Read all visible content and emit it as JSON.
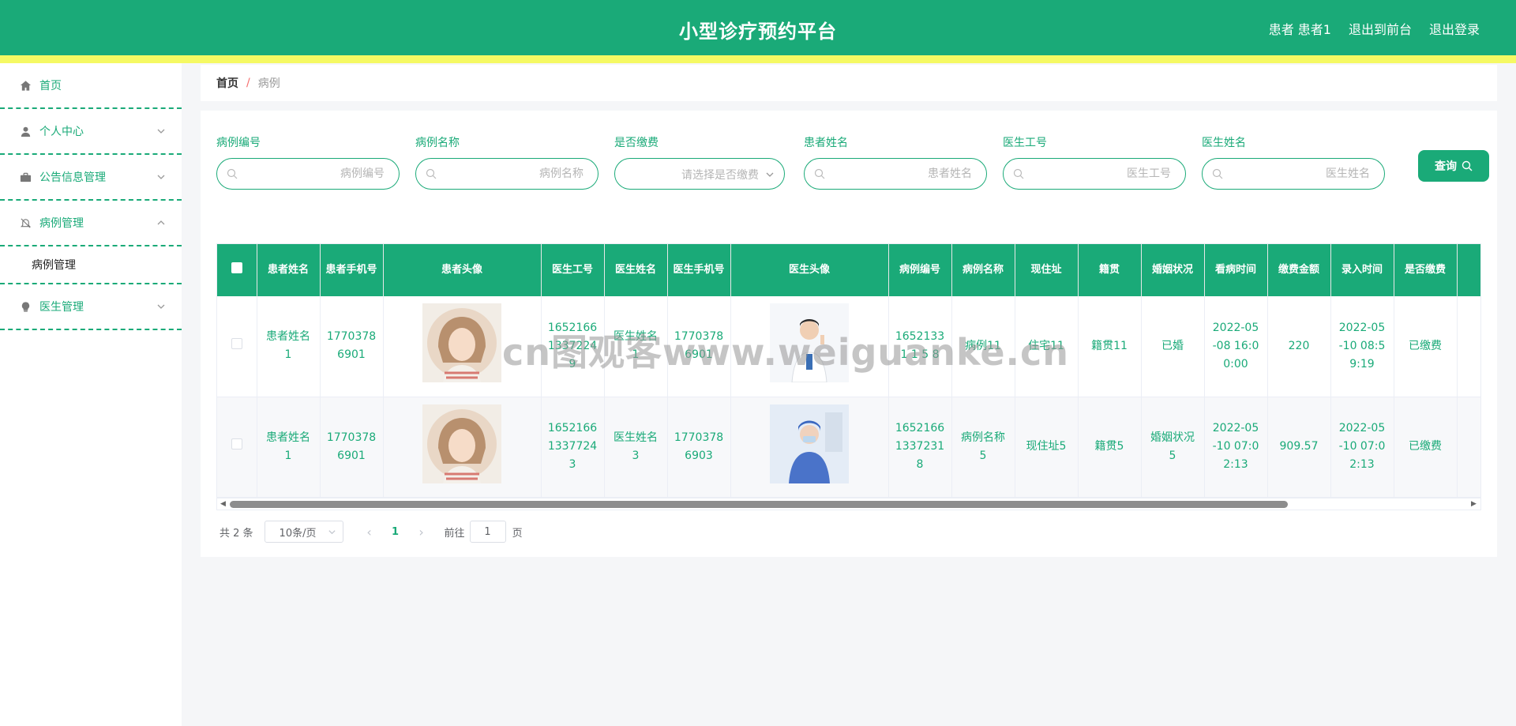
{
  "header": {
    "title": "小型诊疗预约平台",
    "user_label": "患者 患者1",
    "exit_front_label": "退出到前台",
    "logout_label": "退出登录"
  },
  "sidebar": {
    "items": [
      {
        "label": "首页",
        "icon": "home-icon"
      },
      {
        "label": "个人中心",
        "icon": "user-icon"
      },
      {
        "label": "公告信息管理",
        "icon": "briefcase-icon"
      },
      {
        "label": "病例管理",
        "icon": "bell-off-icon"
      },
      {
        "label": "医生管理",
        "icon": "lightbulb-icon"
      }
    ],
    "sub_items": [
      {
        "label": "病例管理"
      }
    ]
  },
  "breadcrumb": {
    "home": "首页",
    "separator": "/",
    "current": "病例"
  },
  "search": {
    "fields": [
      {
        "label": "病例编号",
        "placeholder": "病例编号"
      },
      {
        "label": "病例名称",
        "placeholder": "病例名称"
      },
      {
        "label": "是否缴费",
        "placeholder": "请选择是否缴费"
      },
      {
        "label": "患者姓名",
        "placeholder": "患者姓名"
      },
      {
        "label": "医生工号",
        "placeholder": "医生工号"
      },
      {
        "label": "医生姓名",
        "placeholder": "医生姓名"
      }
    ],
    "query_label": "查询"
  },
  "table": {
    "columns": [
      "患者姓名",
      "患者手机号",
      "患者头像",
      "医生工号",
      "医生姓名",
      "医生手机号",
      "医生头像",
      "病例编号",
      "病例名称",
      "现住址",
      "籍贯",
      "婚姻状况",
      "看病时间",
      "缴费金额",
      "录入时间",
      "是否缴费"
    ],
    "rows": [
      {
        "patient_name": "患者姓名1",
        "patient_phone": "17703786901",
        "doctor_no": "16521661337224 9",
        "doctor_name": "医生姓名1",
        "doctor_phone": "17703786901",
        "case_no": "16521331 1 5 8",
        "case_name": "病例11",
        "address": "住宅11",
        "native_place": "籍贯11",
        "marital": "已婚",
        "visit_time": "2022-05-08 16:00:00",
        "fee": "220",
        "entry_time": "2022-05-10 08:59:19",
        "paid": "已缴费"
      },
      {
        "patient_name": "患者姓名1",
        "patient_phone": "17703786901",
        "doctor_no": "16521661337724 3",
        "doctor_name": "医生姓名3",
        "doctor_phone": "17703786903",
        "case_no": "16521661337231 8",
        "case_name": "病例名称5",
        "address": "现住址5",
        "native_place": "籍贯5",
        "marital": "婚姻状况5",
        "visit_time": "2022-05-10 07:02:13",
        "fee": "909.57",
        "entry_time": "2022-05-10 07:02:13",
        "paid": "已缴费"
      }
    ]
  },
  "pagination": {
    "total": "共 2 条",
    "page_size": "10条/页",
    "current_page": "1",
    "goto_label": "前往",
    "goto_value": "1",
    "page_label": "页"
  },
  "watermark": "cn图观客www.weiguanke.cn",
  "colors": {
    "primary": "#1aaa78",
    "accent_strip": "#f5f963"
  }
}
